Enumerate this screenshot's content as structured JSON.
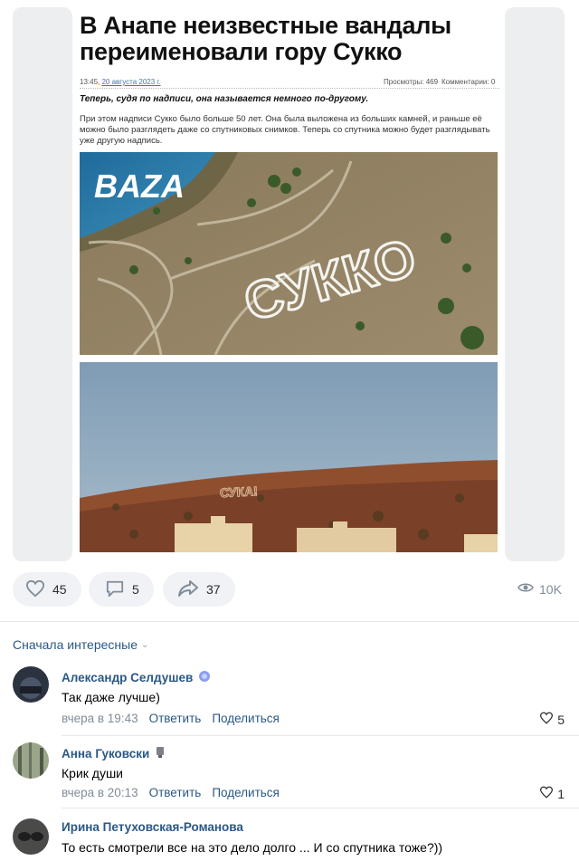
{
  "article": {
    "headline": "В Анапе неизвестные вандалы переименовали гору Сукко",
    "time": "13:45,",
    "date_link": "20 августа 2023 г.",
    "views": "Просмотры: 469",
    "comments": "Комментарии: 0",
    "lead": "Теперь, судя по надписи, она называется немного по-другому.",
    "body": "При этом надписи Сукко было больше 50 лет. Она была выложена из больших камней, и раньше её можно было разглядеть даже со спутниковых снимков. Теперь со спутника можно будет разглядывать уже другую надпись.",
    "photo_logo": "BAZA",
    "photo1_sign": "СУККО",
    "photo2_sign": "СУКА!"
  },
  "actions": {
    "likes": "45",
    "comments": "5",
    "shares": "37",
    "views": "10K"
  },
  "sort_label": "Сначала интересные",
  "comments": [
    {
      "name": "Александр Селдушев",
      "text": "Так даже лучше)",
      "time": "вчера в 19:43",
      "reply": "Ответить",
      "share": "Поделиться",
      "likes": "5"
    },
    {
      "name": "Анна Гуковски",
      "text": "Крик души",
      "time": "вчера в 20:13",
      "reply": "Ответить",
      "share": "Поделиться",
      "likes": "1"
    },
    {
      "name": "Ирина Петуховская-Романова",
      "text": "То есть смотрели все на это дело долго ... И со спутника тоже?))"
    }
  ],
  "colors": {
    "link": "#2a5885",
    "pill_bg": "#f0f2f5",
    "muted": "#818c99"
  }
}
